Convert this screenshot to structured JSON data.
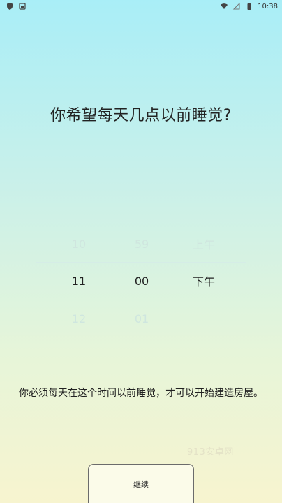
{
  "status_bar": {
    "time": "10:38",
    "left_icons": [
      "shield-icon",
      "gallery-icon"
    ],
    "right_icons": [
      "wifi-icon",
      "signal-icon",
      "battery-icon"
    ]
  },
  "title": "你希望每天几点以前睡觉?",
  "picker": {
    "hours": [
      "10",
      "11",
      "12"
    ],
    "minutes": [
      "59",
      "00",
      "01"
    ],
    "periods": [
      "上午",
      "下午",
      ""
    ],
    "selected_index": 1
  },
  "description": "你必须每天在这个时间以前睡觉，才可以开始建造房屋。",
  "watermark": "913安卓网",
  "button": {
    "label": "继续"
  },
  "colors": {
    "bg_top": "#a9eef7",
    "bg_bottom": "#f7f4cf",
    "text": "#222222",
    "faded_text": "#cfe6df"
  }
}
